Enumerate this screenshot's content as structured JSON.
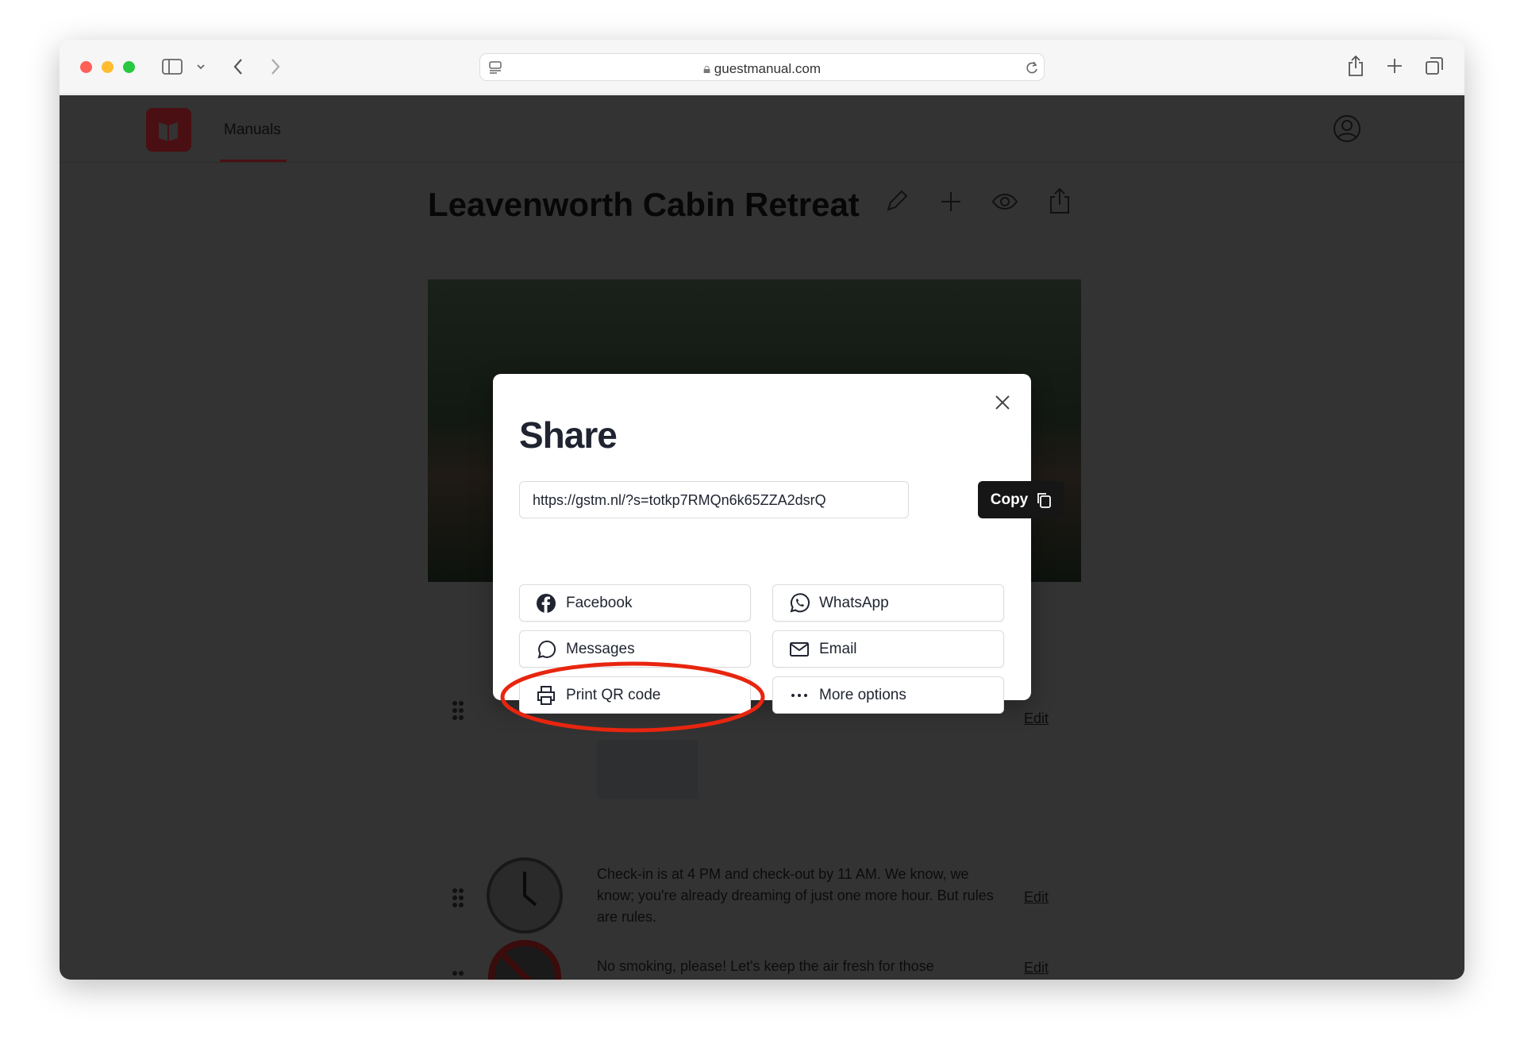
{
  "browser": {
    "url": "guestmanual.com"
  },
  "app": {
    "nav_manuals": "Manuals",
    "brand_color": "#c0262d"
  },
  "manual": {
    "title": "Leavenworth Cabin Retreat",
    "items": [
      {
        "edit": "Edit"
      },
      {
        "text": "Check-in is at 4 PM and check-out by 11 AM. We know, we know; you're already dreaming of just one more hour. But rules are rules.",
        "edit": "Edit"
      },
      {
        "text": "No smoking, please! Let's keep the air fresh for those",
        "edit": "Edit"
      }
    ]
  },
  "share": {
    "title": "Share",
    "link": "https://gstm.nl/?s=totkp7RMQn6k65ZZA2dsrQ",
    "copy": "Copy",
    "options": {
      "facebook": "Facebook",
      "whatsapp": "WhatsApp",
      "messages": "Messages",
      "email": "Email",
      "print_qr": "Print QR code",
      "more": "More options"
    },
    "highlight_color": "#e8250f"
  }
}
